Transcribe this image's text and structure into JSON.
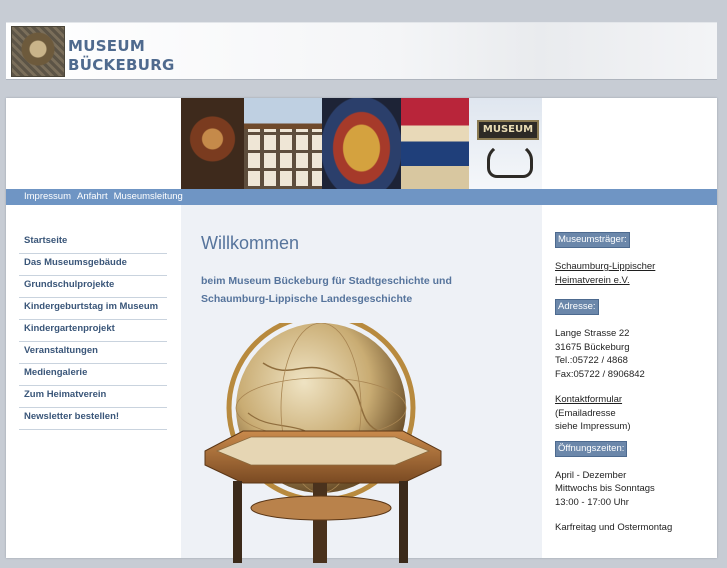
{
  "header": {
    "logo_alt": "museum-emblem",
    "title_line1": "MUSEUM",
    "title_line2": "BÜCKEBURG"
  },
  "banner": {
    "sign_text": "MUSEUM"
  },
  "topnav": {
    "items": [
      "Impressum",
      "Anfahrt",
      "Museumsleitung"
    ]
  },
  "sidebar": {
    "items": [
      "Startseite",
      "Das Museumsgebäude",
      "Grundschulprojekte",
      "Kindergeburtstag im Museum",
      "Kindergartenprojekt",
      "Veranstaltungen",
      "Mediengalerie",
      "Zum Heimatverein",
      "Newsletter bestellen!"
    ]
  },
  "main": {
    "title": "Willkommen",
    "subtitle_line1": "beim Museum Bückeburg für Stadtgeschichte und",
    "subtitle_line2": "Schaumburg-Lippische Landesgeschichte"
  },
  "info": {
    "traeger_label": "Museumsträger:",
    "traeger_line1": "Schaumburg-Lippischer",
    "traeger_line2": "Heimatverein e.V.",
    "adresse_label": "Adresse:",
    "street": "Lange Strasse 22",
    "city": "31675 Bückeburg",
    "tel": "Tel.:05722 / 4868",
    "fax": "Fax:05722 / 8906842",
    "kontakt_link": "Kontaktformular",
    "email_line1": "(Emailadresse",
    "email_line2": "siehe Impressum)",
    "oeffnung_label": "Öffnungszeiten:",
    "season": "April - Dezember",
    "days": "Mittwochs bis Sonntags",
    "hours": "13:00 - 17:00 Uhr",
    "closed": "Karfreitag und Ostermontag"
  },
  "colors": {
    "navbar": "#6f95c4",
    "link_text": "#3a5679",
    "heading": "#56749c",
    "badge": "#6b87aa",
    "center_bg": "#eef1f6",
    "page_bg": "#c7ccd4"
  }
}
